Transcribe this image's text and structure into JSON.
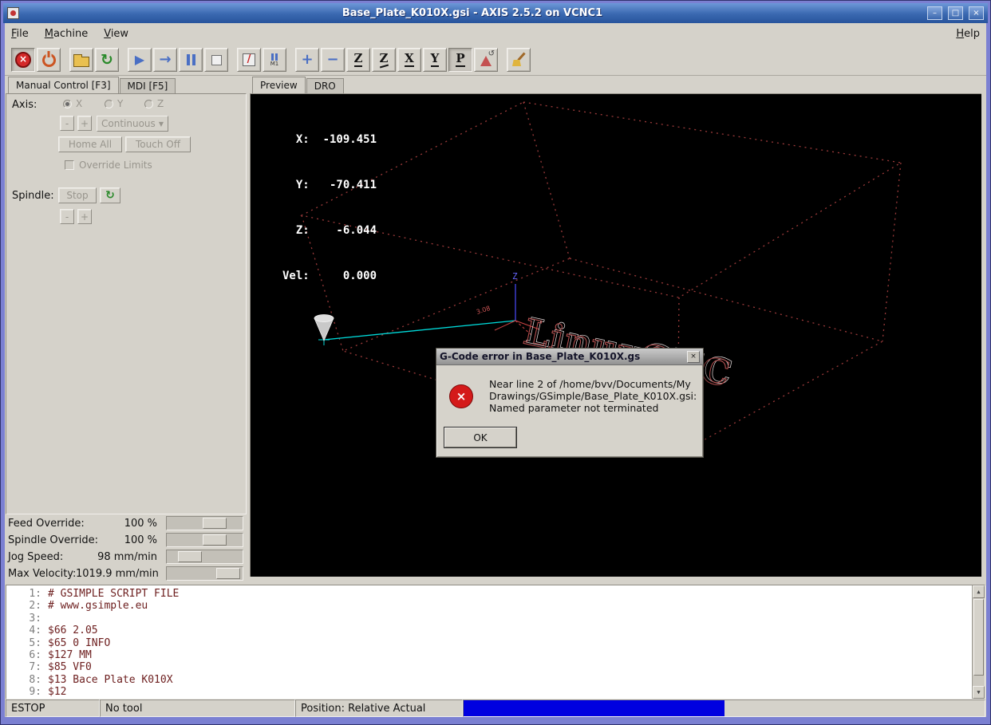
{
  "window": {
    "title": "Base_Plate_K010X.gsi - AXIS 2.5.2 on VCNC1"
  },
  "icons": {
    "minimize": "–",
    "maximize": "□",
    "close": "×",
    "estop": "×",
    "reload": "↻",
    "run": "▶",
    "step": "→",
    "rotate_arrow": "↺",
    "spindle_turn": "↻",
    "dropdown_arrow": "▼",
    "scroll_up": "▲",
    "scroll_down": "▼",
    "error": "×"
  },
  "menubar": {
    "items": [
      "File",
      "Machine",
      "View"
    ],
    "help": "Help"
  },
  "toolbar": {
    "skip": "/",
    "m1": "M1",
    "zoom_in": "+",
    "zoom_out": "−",
    "view_top": "Z",
    "view_rotated_top": "Z",
    "view_side": "X",
    "view_front": "Y",
    "view_perspective": "P"
  },
  "manual": {
    "tabs": [
      "Manual Control [F3]",
      "MDI [F5]"
    ],
    "axis_label": "Axis:",
    "axis_x": "X",
    "axis_y": "Y",
    "axis_z": "Z",
    "jog_minus": "-",
    "jog_plus": "+",
    "jog_mode": "Continuous",
    "home_all": "Home All",
    "touch_off": "Touch Off",
    "override_limits": "Override Limits",
    "spindle_label": "Spindle:",
    "spindle_stop": "Stop",
    "spindle_minus": "-",
    "spindle_plus": "+",
    "overrides": [
      {
        "label": "Feed Override:",
        "value": "100 %"
      },
      {
        "label": "Spindle Override:",
        "value": "100 %"
      },
      {
        "label": "Jog Speed:",
        "value": "98 mm/min"
      },
      {
        "label": "Max Velocity:",
        "value": "1019.9 mm/min"
      }
    ]
  },
  "preview": {
    "tabs": [
      "Preview",
      "DRO"
    ],
    "dro_lines": [
      "  X:  -109.451",
      "  Y:   -70.411",
      "  Z:    -6.044",
      "Vel:     0.000"
    ],
    "axis_z": "Z",
    "origin_label": "3.08",
    "watermark": "LinuxCNC"
  },
  "dialog": {
    "title": "G-Code error in Base_Plate_K010X.gs",
    "message_lines": [
      "Near line 2 of /home/bvv/Documents/My",
      "Drawings/GSimple/Base_Plate_K010X.gsi:",
      "Named parameter not terminated"
    ],
    "ok": "OK"
  },
  "gcode": {
    "lines": [
      {
        "num": "1:",
        "text": "# GSIMPLE SCRIPT FILE"
      },
      {
        "num": "2:",
        "text": "# www.gsimple.eu"
      },
      {
        "num": "3:",
        "text": ""
      },
      {
        "num": "4:",
        "text": "$66 2.05"
      },
      {
        "num": "5:",
        "text": "$65 0 INFO"
      },
      {
        "num": "6:",
        "text": "$127 MM"
      },
      {
        "num": "7:",
        "text": "$85 VF0"
      },
      {
        "num": "8:",
        "text": "$13 Bace Plate K010X"
      },
      {
        "num": "9:",
        "text": "$12"
      }
    ]
  },
  "statusbar": {
    "machine_state": "ESTOP",
    "tool": "No tool",
    "position": "Position: Relative Actual"
  },
  "colors": {
    "titlebar_blue": "#2e5aa4",
    "window_border": "#7b80d2",
    "estop_red": "#d42a2a",
    "toolpath_cyan": "#00dcdc",
    "limits_red": "#9b3a3a",
    "progress_blue": "#0000e0",
    "gcode_text": "#6e2020"
  }
}
